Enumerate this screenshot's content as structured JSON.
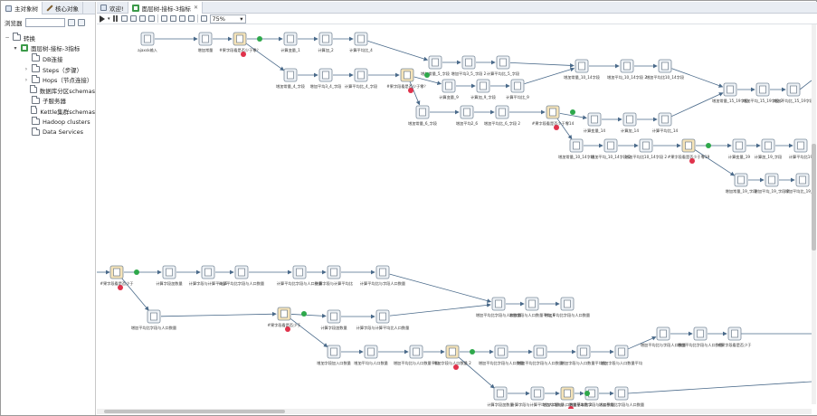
{
  "left_tabs": [
    {
      "label": "主对象树"
    },
    {
      "label": "核心对象"
    }
  ],
  "search": {
    "label": "浏览器",
    "value": ""
  },
  "tree": {
    "root": "转换",
    "transformation": "面层树-接标-3指标",
    "children": [
      {
        "label": "DB连接"
      },
      {
        "label": "Steps（步骤）"
      },
      {
        "label": "Hops（节点连接）"
      },
      {
        "label": "数据库分区schemas"
      },
      {
        "label": "子服务器"
      },
      {
        "label": "Kettle集群schemas"
      },
      {
        "label": "Hadoop clusters"
      },
      {
        "label": "Data Services"
      }
    ]
  },
  "canvas_tabs": [
    {
      "label": "欢迎!"
    },
    {
      "label": "面层树-接标-3指标"
    }
  ],
  "zoom": "75%",
  "icons": {
    "run": "play-icon",
    "pause": "pause-icon",
    "stop": "stop-icon",
    "preview": "preview-icon",
    "debug": "debug-icon",
    "close": "close-icon"
  },
  "colors": {
    "hop": "#4a6a8a",
    "ok": "#2ea84b",
    "error": "#e0324b",
    "step_fill": "#eef2f6",
    "filter_fill": "#f5e3b8"
  },
  "flow": {
    "steps": [
      {
        "id": "s1",
        "label": "ajaxsk输入"
      },
      {
        "id": "s2",
        "label": "增加常量"
      },
      {
        "id": "s3",
        "label": "#果字段看是否少于零？"
      },
      {
        "id": "s4",
        "label": "计算变量_1"
      },
      {
        "id": "s5",
        "label": "计算加_2"
      },
      {
        "id": "s6",
        "label": "计算平均比_4"
      },
      {
        "id": "s7",
        "label": "增加常量_5_字段"
      },
      {
        "id": "s8",
        "label": "增加平均3_5_字段 2"
      },
      {
        "id": "s9",
        "label": "计算平均比_5_字段"
      },
      {
        "id": "s10",
        "label": "增加常量_4_字段"
      },
      {
        "id": "s11",
        "label": "增加平均3_4_字段"
      },
      {
        "id": "s12",
        "label": "计算平均比_4_字段"
      },
      {
        "id": "s13",
        "label": "#果字段看是否少于零？"
      },
      {
        "id": "s14",
        "label": "计算变量_9"
      },
      {
        "id": "s15",
        "label": "计算加_9_字段"
      },
      {
        "id": "s16",
        "label": "计算平均比_9"
      },
      {
        "id": "s17",
        "label": "增加常量_10_14字段"
      },
      {
        "id": "s18",
        "label": "增加平均_10_14字段 2"
      },
      {
        "id": "s19",
        "label": "增加平均比10_14字段"
      },
      {
        "id": "s20",
        "label": "增加常量_6_字段"
      },
      {
        "id": "s21",
        "label": "增加平均2_6"
      },
      {
        "id": "s22",
        "label": "增加平均比_6_字段 2"
      },
      {
        "id": "s23",
        "label": "#果字段看是否少于零14"
      },
      {
        "id": "s24",
        "label": "计算变量_14"
      },
      {
        "id": "s25",
        "label": "计算加_14"
      },
      {
        "id": "s26",
        "label": "计算平均比_14"
      },
      {
        "id": "s27",
        "label": "增加常量_15_19字段"
      },
      {
        "id": "s28",
        "label": "增加平均_15_19字段 2"
      },
      {
        "id": "s29",
        "label": "增加平均比_15_19字段"
      },
      {
        "id": "s30",
        "label": "增加常量_10_14字段"
      },
      {
        "id": "s31",
        "label": "增加平均_10_14字段 2"
      },
      {
        "id": "s32",
        "label": "增加平均比10_14字段 2"
      },
      {
        "id": "s33",
        "label": "#果字段看是否少于零19"
      },
      {
        "id": "s34",
        "label": "计算变量_19"
      },
      {
        "id": "s35",
        "label": "计算加_19_字段"
      },
      {
        "id": "s36",
        "label": "计算平均比19"
      },
      {
        "id": "s37",
        "label": "增加常量_19_字段"
      },
      {
        "id": "s38",
        "label": "增加平均_19_字段 2"
      },
      {
        "id": "s39",
        "label": "增加平均比_19_字段"
      },
      {
        "id": "s40",
        "label": "#果字段看是否少于"
      },
      {
        "id": "s41",
        "label": "计算字段加数量"
      },
      {
        "id": "s42",
        "label": "计算字段与计算平均_6"
      },
      {
        "id": "s43",
        "label": "计算平均比字段与人口数量"
      },
      {
        "id": "s44",
        "label": "计算平均比字段与人口数量"
      },
      {
        "id": "s45",
        "label": "计算字段与计算平均比"
      },
      {
        "id": "s46",
        "label": "计算平均比与字段人口数量"
      },
      {
        "id": "s47",
        "label": "增加平均比字段与人口数量"
      },
      {
        "id": "s48",
        "label": "增加字段与人口数量平均_6"
      },
      {
        "id": "s49",
        "label": "增加平均比字段与人口数量"
      },
      {
        "id": "s50",
        "label": "增加平均比字段与人口数量"
      },
      {
        "id": "s51",
        "label": "#果字段看是否少于"
      },
      {
        "id": "s52",
        "label": "计算字段加数量"
      },
      {
        "id": "s53",
        "label": "计算字段与计算平均比人口数量"
      },
      {
        "id": "s54",
        "label": "增加字段加入口数量"
      },
      {
        "id": "s55",
        "label": "增加平均与人口数量"
      },
      {
        "id": "s56",
        "label": "增加平均比与人口数量平均"
      },
      {
        "id": "s57",
        "label": "增加字段与人口数量 2"
      },
      {
        "id": "s58",
        "label": "增加平均比字段与人口数量"
      },
      {
        "id": "s59",
        "label": "增加平均比字段与人口数量"
      },
      {
        "id": "s60",
        "label": "增加字段与人口数量平均比"
      },
      {
        "id": "s61",
        "label": "增加字段与人口数量平均"
      },
      {
        "id": "s62",
        "label": "增加平均比与字段人口数量"
      },
      {
        "id": "s63",
        "label": "增加平均比字段与人口数量"
      },
      {
        "id": "s64",
        "label": "#果字段看是否少于"
      },
      {
        "id": "s65",
        "label": "计算字段加数量"
      },
      {
        "id": "s66",
        "label": "计算字段与计算平均比人口数量"
      },
      {
        "id": "s67",
        "label": "增加字段与人口数量基本数 2"
      },
      {
        "id": "s68",
        "label": "增加平均比字段与人口数量"
      },
      {
        "id": "s69",
        "label": "增加平均比字段与人口数量"
      }
    ]
  }
}
